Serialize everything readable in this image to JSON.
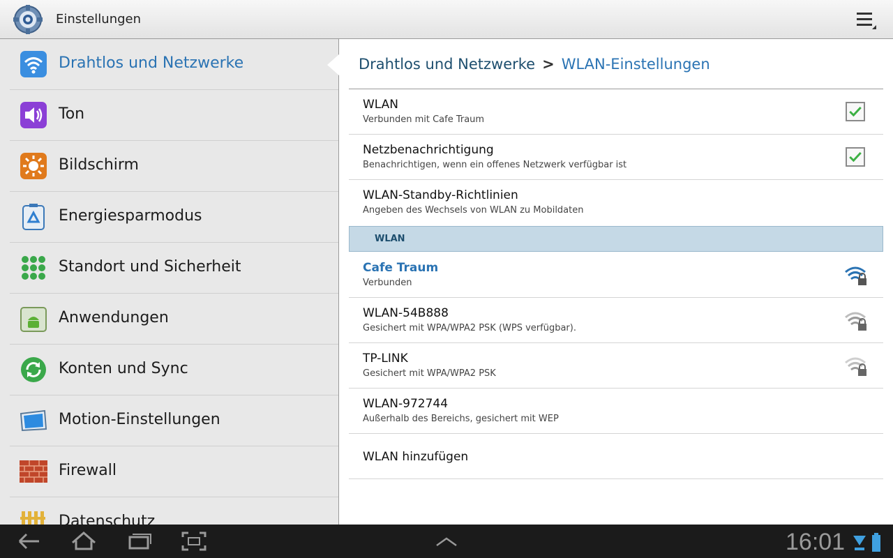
{
  "app": {
    "title": "Einstellungen"
  },
  "sidebar": {
    "items": [
      {
        "label": "Drahtlos und Netzwerke",
        "icon": "wifi-icon",
        "active": true
      },
      {
        "label": "Ton",
        "icon": "speaker-icon"
      },
      {
        "label": "Bildschirm",
        "icon": "brightness-icon"
      },
      {
        "label": "Energiesparmodus",
        "icon": "recycle-icon"
      },
      {
        "label": "Standort und Sicherheit",
        "icon": "location-grid-icon"
      },
      {
        "label": "Anwendungen",
        "icon": "android-icon"
      },
      {
        "label": "Konten und Sync",
        "icon": "sync-icon"
      },
      {
        "label": "Motion-Einstellungen",
        "icon": "motion-icon"
      },
      {
        "label": "Firewall",
        "icon": "brick-wall-icon"
      },
      {
        "label": "Datenschutz",
        "icon": "fence-icon"
      }
    ]
  },
  "breadcrumb": {
    "parent": "Drahtlos und Netzwerke",
    "separator": ">",
    "current": "WLAN-Einstellungen"
  },
  "settings": [
    {
      "title": "WLAN",
      "subtitle": "Verbunden mit Cafe Traum",
      "checked": true
    },
    {
      "title": "Netzbenachrichtigung",
      "subtitle": "Benachrichtigen, wenn ein offenes Netzwerk verfügbar ist",
      "checked": true
    },
    {
      "title": "WLAN-Standby-Richtlinien",
      "subtitle": "Angeben des Wechsels von WLAN zu Mobildaten"
    }
  ],
  "networks_header": "WLAN",
  "networks": [
    {
      "ssid": "Cafe Traum",
      "status": "Verbunden",
      "icon": "wifi-lock-icon",
      "connected": true
    },
    {
      "ssid": "WLAN-54B888",
      "status": "Gesichert mit WPA/WPA2 PSK (WPS verfügbar).",
      "icon": "wifi-lock-icon"
    },
    {
      "ssid": "TP-LINK",
      "status": "Gesichert mit WPA/WPA2 PSK",
      "icon": "wifi-lock-icon"
    },
    {
      "ssid": "WLAN-972744",
      "status": "Außerhalb des Bereichs, gesichert mit WEP"
    }
  ],
  "add_network": "WLAN hinzufügen",
  "systembar": {
    "time": "16:01"
  },
  "colors": {
    "accent": "#2a73b3",
    "section_bg": "#c5d9e6",
    "check": "#3cb043"
  }
}
